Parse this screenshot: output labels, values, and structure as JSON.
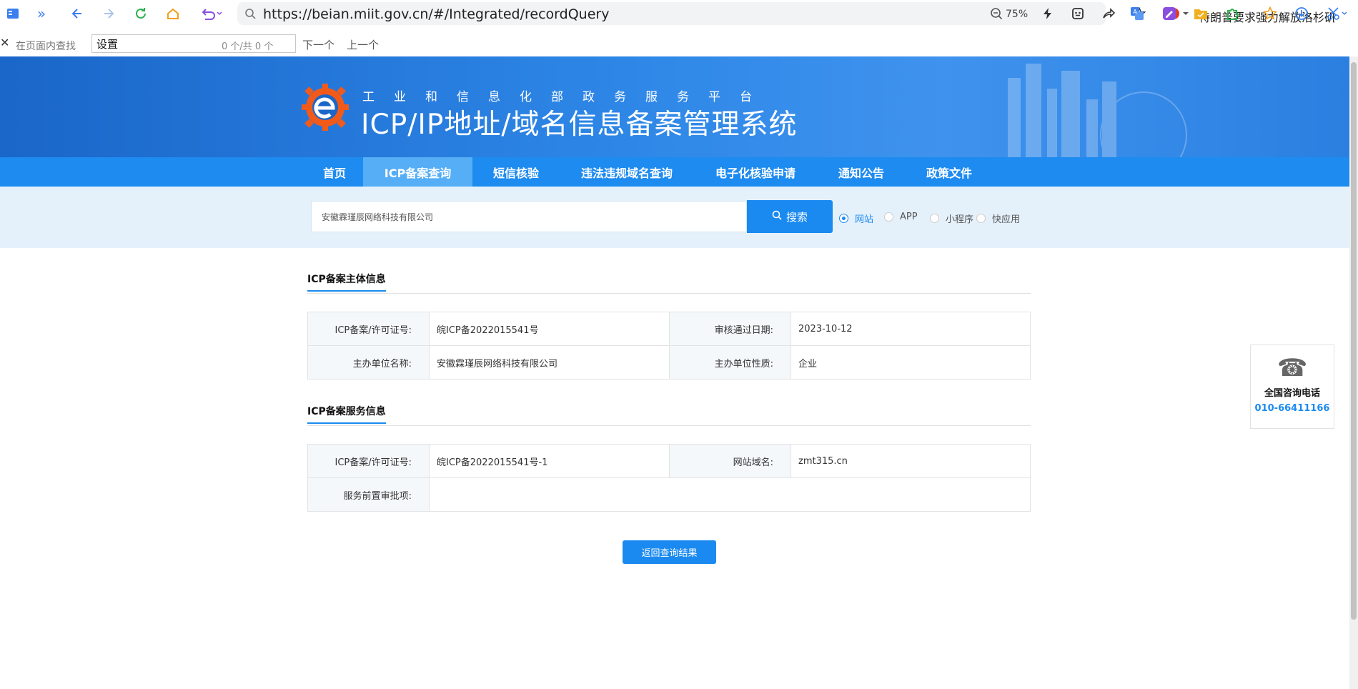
{
  "browser": {
    "url": "https://beian.miit.gov.cn/#/Integrated/recordQuery",
    "zoom": "75%",
    "news_ticker": "特朗普要求强力解放洛杉矶"
  },
  "findbar": {
    "label": "在页面内查找",
    "query": "设置",
    "count": "0 个/共 0 个",
    "next": "下一个",
    "prev": "上一个"
  },
  "header": {
    "subtitle": "工业和信息化部政务服务平台",
    "title": "ICP/IP地址/域名信息备案管理系统"
  },
  "nav": {
    "items": [
      {
        "label": "首页"
      },
      {
        "label": "ICP备案查询"
      },
      {
        "label": "短信核验"
      },
      {
        "label": "违法违规域名查询"
      },
      {
        "label": "电子化核验申请"
      },
      {
        "label": "通知公告"
      },
      {
        "label": "政策文件"
      }
    ],
    "active_index": 1
  },
  "search": {
    "value": "安徽霖瑾辰网络科技有限公司",
    "button": "搜索",
    "options": [
      {
        "label": "网站",
        "checked": true
      },
      {
        "label": "APP",
        "checked": false
      },
      {
        "label": "小程序",
        "checked": false
      },
      {
        "label": "快应用",
        "checked": false
      }
    ]
  },
  "subject_info": {
    "title": "ICP备案主体信息",
    "rows": [
      {
        "label1": "ICP备案/许可证号:",
        "value1": "皖ICP备2022015541号",
        "label2": "审核通过日期:",
        "value2": "2023-10-12"
      },
      {
        "label1": "主办单位名称:",
        "value1": "安徽霖瑾辰网络科技有限公司",
        "label2": "主办单位性质:",
        "value2": "企业"
      }
    ]
  },
  "service_info": {
    "title": "ICP备案服务信息",
    "row1": {
      "label1": "ICP备案/许可证号:",
      "value1": "皖ICP备2022015541号-1",
      "label2": "网站域名:",
      "value2": "zmt315.cn"
    },
    "row2": {
      "label": "服务前置审批项:",
      "value": ""
    }
  },
  "back_button": "返回查询结果",
  "hotline": {
    "label": "全国咨询电话",
    "number": "010-66411166"
  },
  "colors": {
    "primary": "#1a8af0",
    "nav_active": "#55aef6",
    "search_band": "#e4f1fb"
  }
}
